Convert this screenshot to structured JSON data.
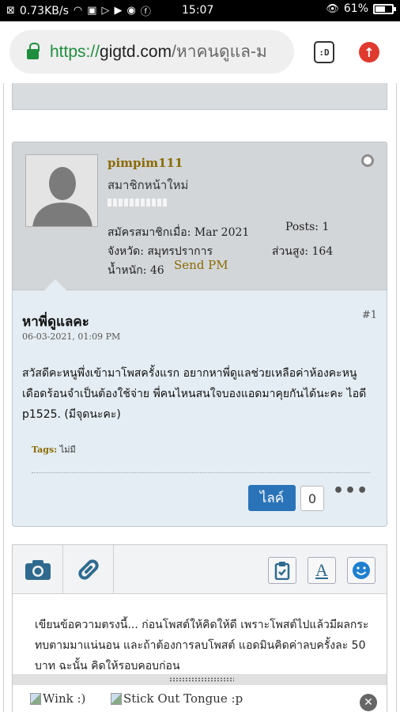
{
  "status_bar": {
    "net_speed": "0.73KB/s",
    "time": "15:07",
    "battery": "61%",
    "battery_level": 0.61,
    "icons": [
      "sim-off-icon",
      "wifi-icon",
      "nfc-icon",
      "play-icon",
      "youtube-icon",
      "vpn-icon",
      "facebook-icon",
      "eye-icon"
    ]
  },
  "browser": {
    "url_scheme": "https://",
    "url_host": "gigtd.com",
    "url_path": "/หาคนดูแล-ม",
    "tab_label": ":D"
  },
  "user": {
    "name": "pimpim111",
    "title": "สมาชิกหน้าใหม่",
    "joined": "สมัครสมาชิกเมื่อ: Mar 2021",
    "posts": "Posts: 1",
    "province": "จังหวัด: สมุทรปราการ",
    "height": "ส่วนสูง: 164",
    "weight": "น้ำหนัก: 46",
    "send_pm": "Send PM"
  },
  "post": {
    "title": "หาพี่ดูแลคะ",
    "number": "#1",
    "date": "06-03-2021, 01:09 PM",
    "body": "สวัสดีคะหนูพึ่งเข้ามาโพสครั้งแรก อยากหาพี่ดูแลช่วยเหลือค่าห้องคะหนูเดือดร้อนจำเป็นต้องใช้จ่าย พี่คนไหนสนใจบองแอดมาคุยกันได้นะคะ ไอดี p1525. (มีจุดนะคะ)",
    "tags_label": "Tags:",
    "tags_value": "ไม่มี",
    "like_label": "ไลค์",
    "like_count": "0",
    "more_label": "•••"
  },
  "editor": {
    "placeholder_text": "เขียนข้อความตรงนี้... ก่อนโพสต์ให้คิดให้ดี เพราะโพสต์ไปแล้วมีผลกระทบตามมาแน่นอน และถ้าต้องการลบโพสต์ แอดมินคิดค่าลบครั้งละ 50 บาท ฉะนั้น คิดให้รอบคอบก่อน",
    "toolbar": [
      "camera-icon",
      "link-icon",
      "clipboard-icon",
      "text-format-icon",
      "smiley-icon"
    ],
    "text_format_label": "A"
  },
  "smilies": [
    "Wink :)",
    "Stick Out Tongue :p"
  ]
}
